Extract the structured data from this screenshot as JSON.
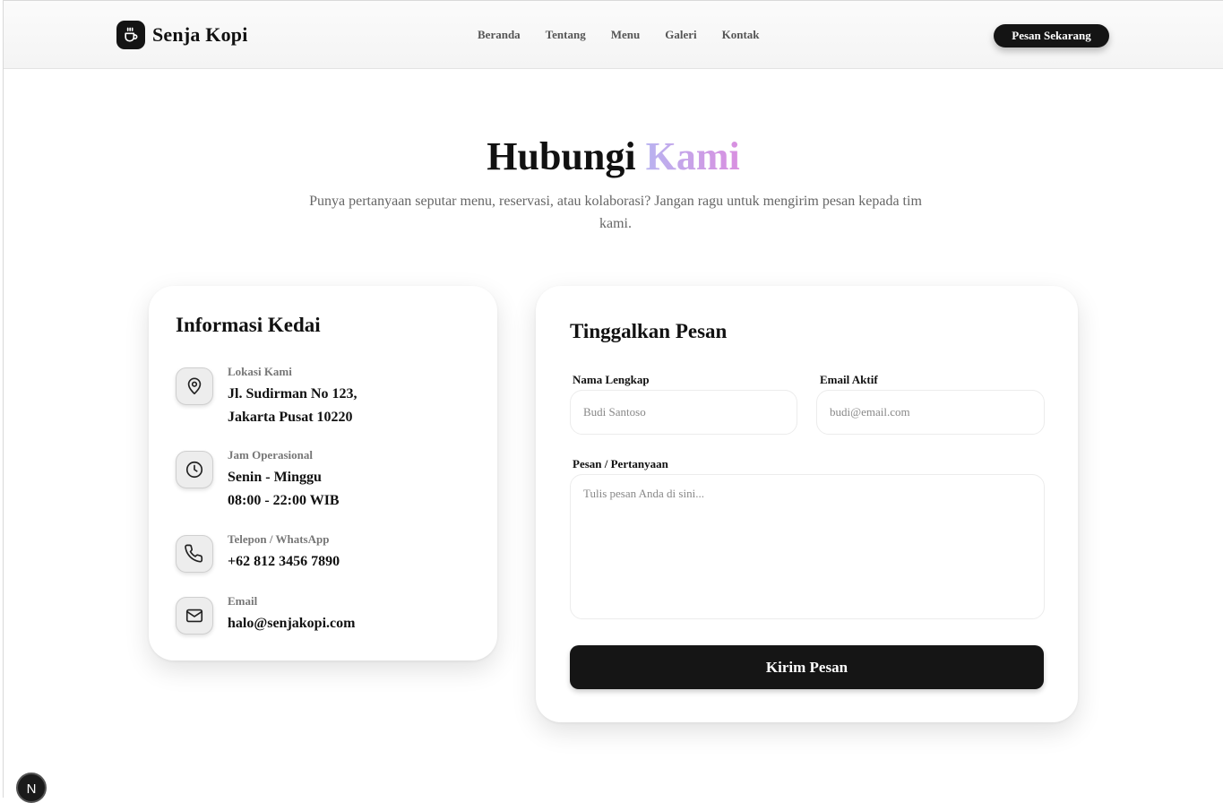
{
  "brand": {
    "name": "Senja Kopi",
    "logo_icon": "coffee-cup-icon"
  },
  "nav": {
    "items": [
      {
        "label": "Beranda"
      },
      {
        "label": "Tentang"
      },
      {
        "label": "Menu"
      },
      {
        "label": "Galeri"
      },
      {
        "label": "Kontak"
      }
    ],
    "cta_label": "Pesan Sekarang"
  },
  "hero": {
    "title_main": "Hubungi",
    "title_accent": "Kami",
    "subtitle": "Punya pertanyaan seputar menu, reservasi, atau kolaborasi? Jangan ragu untuk mengirim pesan kepada tim kami."
  },
  "info": {
    "title": "Informasi Kedai",
    "items": [
      {
        "icon": "map-pin-icon",
        "label": "Lokasi Kami",
        "value_line1": "Jl. Sudirman No 123,",
        "value_line2": "Jakarta Pusat 10220"
      },
      {
        "icon": "clock-icon",
        "label": "Jam Operasional",
        "value_line1": "Senin - Minggu",
        "value_line2": "08:00 - 22:00 WIB"
      },
      {
        "icon": "phone-icon",
        "label": "Telepon / WhatsApp",
        "value_line1": "+62 812 3456 7890",
        "value_line2": ""
      },
      {
        "icon": "mail-icon",
        "label": "Email",
        "value_line1": "halo@senjakopi.com",
        "value_line2": ""
      }
    ]
  },
  "form": {
    "title": "Tinggalkan Pesan",
    "name_label": "Nama Lengkap",
    "name_placeholder": "Budi Santoso",
    "email_label": "Email Aktif",
    "email_placeholder": "budi@email.com",
    "message_label": "Pesan / Pertanyaan",
    "message_placeholder": "Tulis pesan Anda di sini...",
    "submit_label": "Kirim Pesan"
  },
  "dev_badge": {
    "label": "N"
  },
  "colors": {
    "primary": "#141414",
    "accent_start": "#b9b3f0",
    "accent_end": "#d98fe0"
  }
}
